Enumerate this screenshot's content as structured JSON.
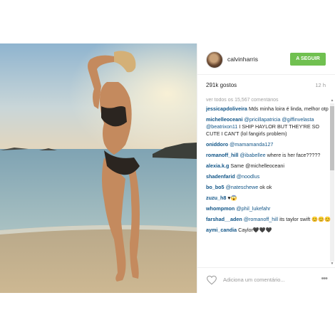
{
  "header": {
    "username": "calvinharris",
    "follow_label": "A SEGUIR"
  },
  "stats": {
    "likes": "291k gostos",
    "time": "12 h"
  },
  "comments_view_all": "ver todos os 15,567 comentários",
  "comments": [
    {
      "user": "jessicapdoliveira",
      "mention": "",
      "text": "Mds minha loira é linda, melhor otp"
    },
    {
      "user": "michelleoceani",
      "mention": "@pricillapatricia @giffinvelasta @beatrixon11",
      "text": "I SHIP HAYLOR BUT THEY'RE SO CUTE I CAN'T (lol fangirls problem)"
    },
    {
      "user": "oniddoro",
      "mention": "@mamamanda127",
      "text": ""
    },
    {
      "user": "romanoff_hill",
      "mention": "@ibabellee",
      "text": "where is her face?????"
    },
    {
      "user": "alexia.k.g",
      "mention": "",
      "text": "Same @michelleoceani"
    },
    {
      "user": "shadenfarid",
      "mention": "@noodlus",
      "text": ""
    },
    {
      "user": "bo_bo5",
      "mention": "@nateschewe",
      "text": "ok ok"
    },
    {
      "user": "zuzu_h8",
      "mention": "",
      "text": "♥😱"
    },
    {
      "user": "whompmon",
      "mention": "@phil_lukefahr",
      "text": ""
    },
    {
      "user": "farshad__aden",
      "mention": "@romanoff_hill",
      "text": "its taylor swift 😊😊😊"
    },
    {
      "user": "aymi_candia",
      "mention": "",
      "text": "Caylor🖤🖤🖤"
    }
  ],
  "footer": {
    "add_comment_placeholder": "Adiciona um comentário...",
    "more_label": "•••"
  },
  "colors": {
    "follow_green": "#70c050",
    "link_blue": "#125688"
  },
  "icons": {
    "heart": "heart-icon",
    "more": "more-options-icon"
  }
}
